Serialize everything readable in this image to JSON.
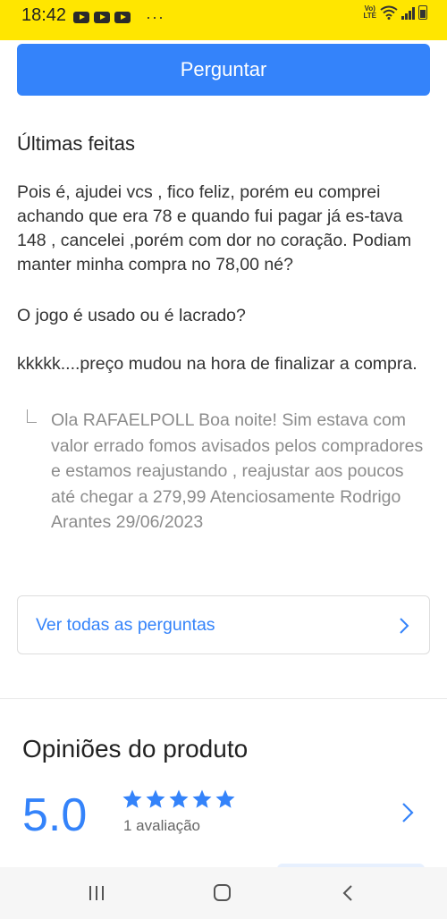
{
  "status_bar": {
    "time": "18:42",
    "overflow": "···",
    "network_label": "Vo) LTE",
    "icons": [
      "youtube-icon",
      "youtube-icon",
      "youtube-icon",
      "wifi-icon",
      "signal-icon",
      "battery-icon"
    ]
  },
  "ask_button": {
    "label": "Perguntar"
  },
  "last_questions": {
    "title": "Últimas feitas",
    "items": [
      {
        "question": "Pois é, ajudei vcs , fico feliz, porém eu comprei achando que era 78 e quando fui pagar já es-tava 148 , cancelei ,porém com dor no coração. Podiam manter minha compra no 78,00 né?"
      },
      {
        "question": "O jogo é usado ou é lacrado?"
      },
      {
        "question": "kkkkk....preço mudou na hora de finalizar a compra.",
        "answer": "Ola RAFAELPOLL Boa noite! Sim estava com valor errado fomos avisados pelos compradores e estamos reajustando , reajustar aos poucos até chegar a 279,99 Atenciosamente Rodrigo Arantes 29/06/2023"
      }
    ]
  },
  "see_all": {
    "label": "Ver todas as perguntas"
  },
  "opinions": {
    "title": "Opiniões do produto",
    "rating": "5.0",
    "stars": 5,
    "count": "1 avaliação"
  },
  "colors": {
    "brand_yellow": "#ffe600",
    "accent_blue": "#3483fa"
  }
}
